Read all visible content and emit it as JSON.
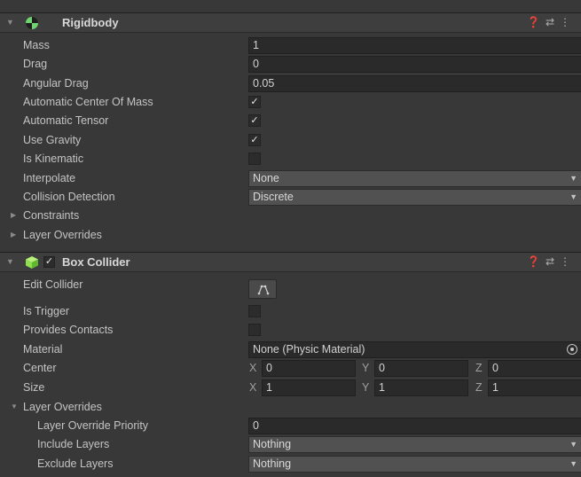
{
  "rigidbody": {
    "title": "Rigidbody",
    "mass_label": "Mass",
    "mass": "1",
    "drag_label": "Drag",
    "drag": "0",
    "angular_drag_label": "Angular Drag",
    "angular_drag": "0.05",
    "auto_com_label": "Automatic Center Of Mass",
    "auto_com": true,
    "auto_tensor_label": "Automatic Tensor",
    "auto_tensor": true,
    "use_gravity_label": "Use Gravity",
    "use_gravity": true,
    "is_kinematic_label": "Is Kinematic",
    "is_kinematic": false,
    "interpolate_label": "Interpolate",
    "interpolate": "None",
    "collision_label": "Collision Detection",
    "collision": "Discrete",
    "constraints_label": "Constraints",
    "layer_overrides_label": "Layer Overrides"
  },
  "box_collider": {
    "title": "Box Collider",
    "enabled": true,
    "edit_collider_label": "Edit Collider",
    "is_trigger_label": "Is Trigger",
    "is_trigger": false,
    "provides_contacts_label": "Provides Contacts",
    "provides_contacts": false,
    "material_label": "Material",
    "material": "None (Physic Material)",
    "center_label": "Center",
    "center": {
      "x": "0",
      "y": "0",
      "z": "0"
    },
    "size_label": "Size",
    "size": {
      "x": "1",
      "y": "1",
      "z": "1"
    },
    "layer_overrides_label": "Layer Overrides",
    "priority_label": "Layer Override Priority",
    "priority": "0",
    "include_label": "Include Layers",
    "include": "Nothing",
    "exclude_label": "Exclude Layers",
    "exclude": "Nothing"
  },
  "axes": {
    "x": "X",
    "y": "Y",
    "z": "Z"
  },
  "glyphs": {
    "check": "✓",
    "dropdown": "▼",
    "collapsed": "▶",
    "expanded": "▼"
  },
  "colors": {
    "background": "#383838",
    "header": "#3e3e3e",
    "field": "#2a2a2a",
    "dropdown": "#515151",
    "rigidbody_icon": "#6fd36f",
    "collider_icon": "#8fe04f"
  }
}
